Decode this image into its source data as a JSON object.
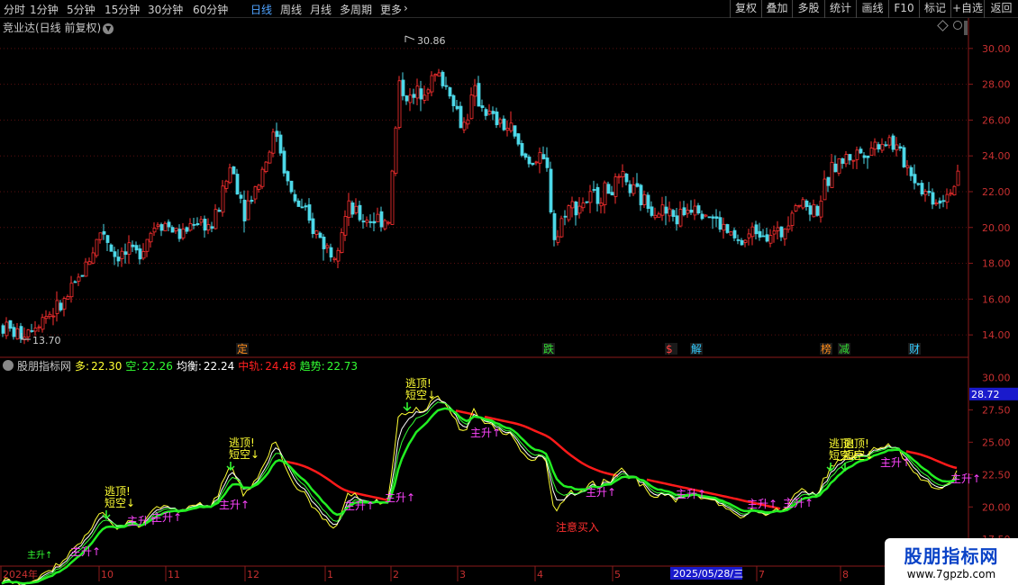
{
  "toolbar": {
    "periods": [
      {
        "label": "分时",
        "active": false
      },
      {
        "label": "1分钟",
        "active": false
      },
      {
        "label": "5分钟",
        "active": false
      },
      {
        "label": "15分钟",
        "active": false
      },
      {
        "label": "30分钟",
        "active": false
      },
      {
        "label": "60分钟",
        "active": false
      },
      {
        "label": "日线",
        "active": true
      },
      {
        "label": "周线",
        "active": false
      },
      {
        "label": "月线",
        "active": false
      },
      {
        "label": "多周期",
        "active": false
      },
      {
        "label": "更多",
        "active": false
      }
    ],
    "buttons": [
      "复权",
      "叠加",
      "多股",
      "统计",
      "画线",
      "F10",
      "标记",
      "+自选",
      "返回"
    ]
  },
  "main": {
    "title": "竞业达(日线 前复权)",
    "y_ticks": [
      "30.00",
      "28.00",
      "26.00",
      "24.00",
      "22.00",
      "20.00",
      "18.00",
      "16.00",
      "14.00"
    ],
    "high_label": "30.86",
    "low_label": "13.70",
    "events": [
      {
        "label": "定",
        "color": "#ff8c1a"
      },
      {
        "label": "跌",
        "color": "#33dd33"
      },
      {
        "label": "$",
        "color": "#ff4040"
      },
      {
        "label": "解",
        "color": "#33ccff"
      },
      {
        "label": "榜",
        "color": "#ff8c1a"
      },
      {
        "label": "减",
        "color": "#33dd33"
      },
      {
        "label": "财",
        "color": "#33ccff"
      }
    ]
  },
  "indicator": {
    "name": "股朋指标网",
    "items": [
      {
        "label": "多:",
        "value": "22.30",
        "color": "#ffff33"
      },
      {
        "label": "空:",
        "value": "22.26",
        "color": "#33ff33"
      },
      {
        "label": "均衡:",
        "value": "22.24",
        "color": "#ffffff"
      },
      {
        "label": "中轨:",
        "value": "24.48",
        "color": "#ff2020"
      },
      {
        "label": "趋势:",
        "value": "22.73",
        "color": "#33ff33"
      }
    ],
    "y_ticks": [
      "27.50",
      "25.00",
      "22.50",
      "20.00",
      "17.50"
    ],
    "partial_tick": "30.00",
    "current_value": "28.72",
    "annotations": {
      "escape_top": "逃顶!",
      "short_sell": "短空↓",
      "rise": "主升↑",
      "notice_buy": "注意买入"
    }
  },
  "x_axis": {
    "labels": [
      "2024年",
      "10",
      "11",
      "12",
      "1",
      "2",
      "3",
      "4",
      "5",
      "7",
      "8"
    ],
    "cursor_date": "2025/05/28/三"
  },
  "watermark": {
    "line1": "股朋指标网",
    "line2": "www.7gpzb.com"
  },
  "chart_data": {
    "type": "candlestick",
    "up_color": "#ff3030",
    "down_color": "#4dd8e8",
    "price_range": [
      13.0,
      31.5
    ],
    "indicator_range": [
      15.5,
      31.0
    ],
    "price_anchors": [
      [
        0,
        14.5
      ],
      [
        20,
        14.0
      ],
      [
        45,
        15.0
      ],
      [
        65,
        15.5
      ],
      [
        80,
        16.5
      ],
      [
        100,
        18.5
      ],
      [
        112,
        20.0
      ],
      [
        125,
        18.5
      ],
      [
        150,
        18.5
      ],
      [
        175,
        20.5
      ],
      [
        200,
        19.5
      ],
      [
        215,
        20.5
      ],
      [
        235,
        20.0
      ],
      [
        255,
        23.5
      ],
      [
        270,
        21.0
      ],
      [
        285,
        22.5
      ],
      [
        305,
        25.5
      ],
      [
        320,
        22.0
      ],
      [
        345,
        20.0
      ],
      [
        368,
        18.5
      ],
      [
        385,
        21.0
      ],
      [
        400,
        20.5
      ],
      [
        430,
        20.5
      ],
      [
        442,
        28.0
      ],
      [
        455,
        27.0
      ],
      [
        470,
        28.0
      ],
      [
        485,
        28.5
      ],
      [
        500,
        27.5
      ],
      [
        512,
        25.5
      ],
      [
        525,
        27.5
      ],
      [
        545,
        26.0
      ],
      [
        565,
        25.5
      ],
      [
        578,
        24.0
      ],
      [
        605,
        23.5
      ],
      [
        615,
        19.0
      ],
      [
        625,
        21.0
      ],
      [
        650,
        21.5
      ],
      [
        690,
        22.5
      ],
      [
        712,
        21.5
      ],
      [
        750,
        20.5
      ],
      [
        770,
        21.5
      ],
      [
        800,
        20.0
      ],
      [
        820,
        19.0
      ],
      [
        840,
        20.0
      ],
      [
        865,
        19.5
      ],
      [
        880,
        21.5
      ],
      [
        905,
        21.0
      ],
      [
        925,
        23.5
      ],
      [
        945,
        24.0
      ],
      [
        965,
        24.5
      ],
      [
        985,
        25.0
      ],
      [
        1005,
        23.5
      ],
      [
        1025,
        22.0
      ],
      [
        1040,
        21.5
      ],
      [
        1060,
        22.5
      ]
    ]
  }
}
